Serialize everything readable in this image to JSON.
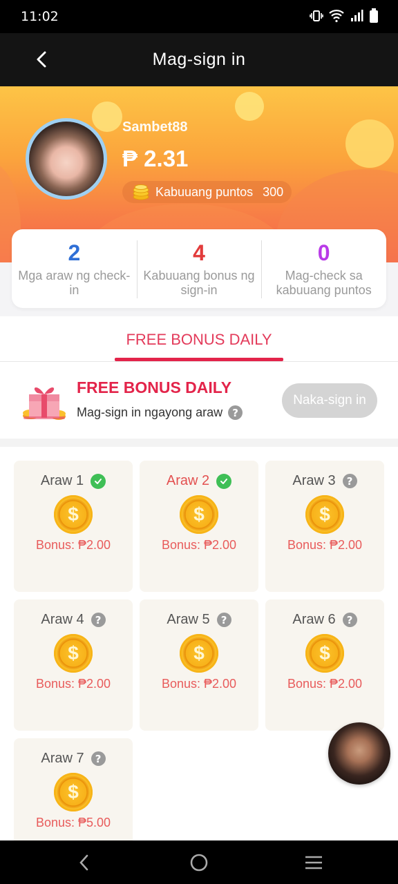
{
  "status_bar": {
    "time": "11:02"
  },
  "header": {
    "title": "Mag-sign in",
    "back_icon": "chevron-left-icon"
  },
  "profile": {
    "username": "Sambet88",
    "balance": "₱ 2.31",
    "points_label": "Kabuuang puntos",
    "points_value": "300"
  },
  "stats": [
    {
      "value": "2",
      "label": "Mga araw ng check-in",
      "color": "#2f6fd6"
    },
    {
      "value": "4",
      "label": "Kabuuang bonus ng sign-in",
      "color": "#e23b3b"
    },
    {
      "value": "0",
      "label": "Mag-check sa kabuuang puntos",
      "color": "#b93be8"
    }
  ],
  "tab": {
    "label": "FREE BONUS DAILY"
  },
  "bonus": {
    "title": "FREE BONUS DAILY",
    "subtitle": "Mag-sign in ngayong araw",
    "button_label": "Naka-sign in"
  },
  "days": [
    {
      "label": "Araw 1",
      "status": "checked",
      "bonus": "Bonus: ₱2.00",
      "active": false
    },
    {
      "label": "Araw 2",
      "status": "checked",
      "bonus": "Bonus: ₱2.00",
      "active": true
    },
    {
      "label": "Araw 3",
      "status": "pending",
      "bonus": "Bonus: ₱2.00",
      "active": false
    },
    {
      "label": "Araw 4",
      "status": "pending",
      "bonus": "Bonus: ₱2.00",
      "active": false
    },
    {
      "label": "Araw 5",
      "status": "pending",
      "bonus": "Bonus: ₱2.00",
      "active": false
    },
    {
      "label": "Araw 6",
      "status": "pending",
      "bonus": "Bonus: ₱2.00",
      "active": false
    },
    {
      "label": "Araw 7",
      "status": "pending",
      "bonus": "Bonus: ₱5.00",
      "active": false
    }
  ],
  "coin_symbol": "$",
  "help_symbol": "?",
  "colors": {
    "accent": "#e3244a",
    "check": "#3fbf56"
  }
}
